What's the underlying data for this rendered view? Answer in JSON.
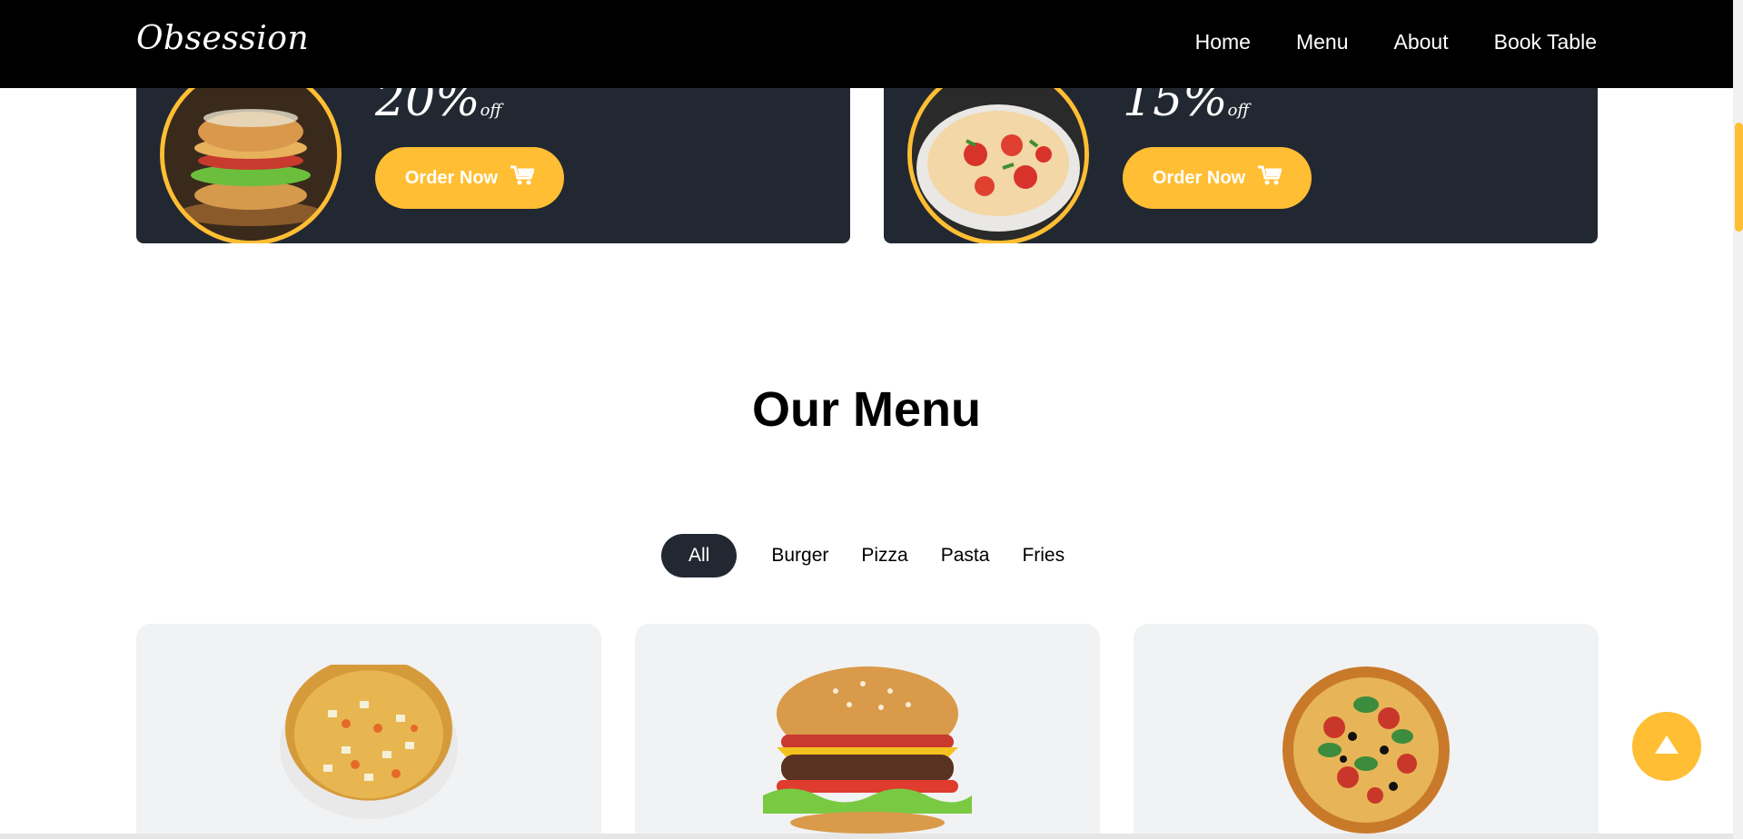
{
  "brand": "Obsession",
  "nav": [
    "Home",
    "Menu",
    "About",
    "Book Table"
  ],
  "offers": [
    {
      "percent": "20%",
      "suffix": "off",
      "button": "Order Now",
      "image": "burger-photo"
    },
    {
      "percent": "15%",
      "suffix": "off",
      "button": "Order Now",
      "image": "pizza-photo"
    }
  ],
  "menu": {
    "title": "Our Menu",
    "filters": [
      "All",
      "Burger",
      "Pizza",
      "Pasta",
      "Fries"
    ],
    "active_filter": "All"
  },
  "products": [
    {
      "image": "veg-pizza-image"
    },
    {
      "image": "cheeseburger-image"
    },
    {
      "image": "basil-pizza-image"
    }
  ],
  "colors": {
    "accent": "#ffbe33",
    "dark": "#222831",
    "navbar": "#000000",
    "card": "#f1f2f3"
  }
}
